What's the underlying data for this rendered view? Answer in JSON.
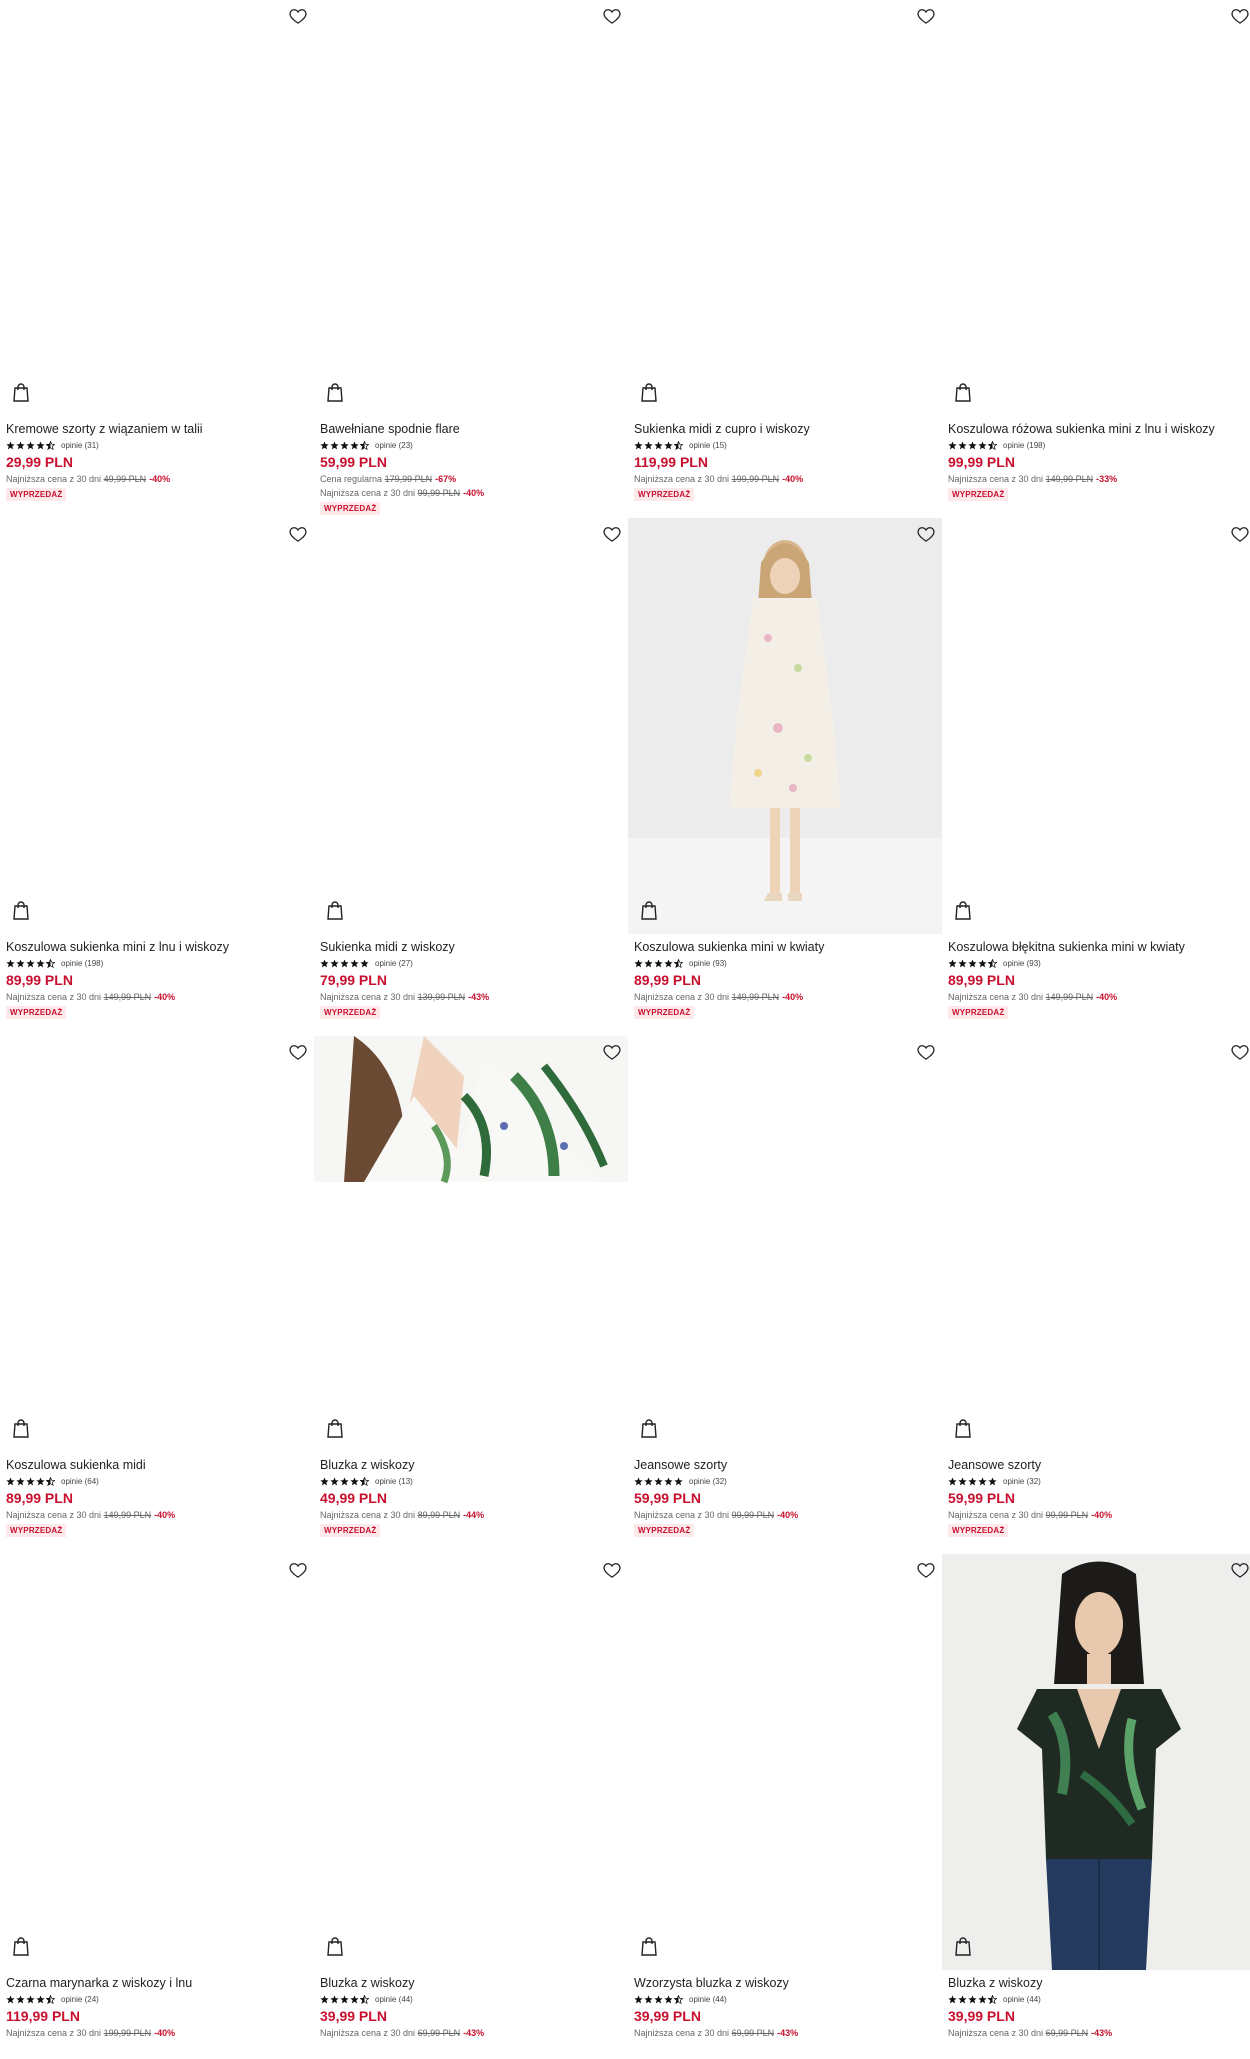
{
  "products": [
    {
      "name": "Kremowe szorty z wiązaniem w talii",
      "reviews": "opinie (31)",
      "price": "29,99 PLN",
      "regular_label": "",
      "regular_old": "",
      "regular_disc": "",
      "lowest_label": "Najniższa cena z 30 dni",
      "lowest_old": "49,99 PLN",
      "lowest_disc": "-40%",
      "badge": "WYPRZEDAŻ",
      "rating": 4.5,
      "image": "blank"
    },
    {
      "name": "Bawełniane spodnie flare",
      "reviews": "opinie (23)",
      "price": "59,99 PLN",
      "regular_label": "Cena regularna",
      "regular_old": "179,99 PLN",
      "regular_disc": "-67%",
      "lowest_label": "Najniższa cena z 30 dni",
      "lowest_old": "99,99 PLN",
      "lowest_disc": "-40%",
      "badge": "WYPRZEDAŻ",
      "rating": 4.5,
      "image": "blank"
    },
    {
      "name": "Sukienka midi z cupro i wiskozy",
      "reviews": "opinie (15)",
      "price": "119,99 PLN",
      "regular_label": "",
      "regular_old": "",
      "regular_disc": "",
      "lowest_label": "Najniższa cena z 30 dni",
      "lowest_old": "199,99 PLN",
      "lowest_disc": "-40%",
      "badge": "WYPRZEDAŻ",
      "rating": 4.5,
      "image": "blank"
    },
    {
      "name": "Koszulowa różowa sukienka mini z lnu i wiskozy",
      "reviews": "opinie (198)",
      "price": "99,99 PLN",
      "regular_label": "",
      "regular_old": "",
      "regular_disc": "",
      "lowest_label": "Najniższa cena z 30 dni",
      "lowest_old": "149,99 PLN",
      "lowest_disc": "-33%",
      "badge": "WYPRZEDAŻ",
      "rating": 4.5,
      "image": "blank"
    },
    {
      "name": "Koszulowa sukienka mini z lnu i wiskozy",
      "reviews": "opinie (198)",
      "price": "89,99 PLN",
      "regular_label": "",
      "regular_old": "",
      "regular_disc": "",
      "lowest_label": "Najniższa cena z 30 dni",
      "lowest_old": "149,99 PLN",
      "lowest_disc": "-40%",
      "badge": "WYPRZEDAŻ",
      "rating": 4.5,
      "image": "blank"
    },
    {
      "name": "Sukienka midi z wiskozy",
      "reviews": "opinie (27)",
      "price": "79,99 PLN",
      "regular_label": "",
      "regular_old": "",
      "regular_disc": "",
      "lowest_label": "Najniższa cena z 30 dni",
      "lowest_old": "139,99 PLN",
      "lowest_disc": "-43%",
      "badge": "WYPRZEDAŻ",
      "rating": 5,
      "image": "blank"
    },
    {
      "name": "Koszulowa sukienka mini w kwiaty",
      "reviews": "opinie (93)",
      "price": "89,99 PLN",
      "regular_label": "",
      "regular_old": "",
      "regular_disc": "",
      "lowest_label": "Najniższa cena z 30 dni",
      "lowest_old": "149,99 PLN",
      "lowest_disc": "-40%",
      "badge": "WYPRZEDAŻ",
      "rating": 4.5,
      "image": "dress"
    },
    {
      "name": "Koszulowa błękitna sukienka mini w kwiaty",
      "reviews": "opinie (93)",
      "price": "89,99 PLN",
      "regular_label": "",
      "regular_old": "",
      "regular_disc": "",
      "lowest_label": "Najniższa cena z 30 dni",
      "lowest_old": "149,99 PLN",
      "lowest_disc": "-40%",
      "badge": "WYPRZEDAŻ",
      "rating": 4.5,
      "image": "blank"
    },
    {
      "name": "Koszulowa sukienka midi",
      "reviews": "opinie (64)",
      "price": "89,99 PLN",
      "regular_label": "",
      "regular_old": "",
      "regular_disc": "",
      "lowest_label": "Najniższa cena z 30 dni",
      "lowest_old": "149,99 PLN",
      "lowest_disc": "-40%",
      "badge": "WYPRZEDAŻ",
      "rating": 4.5,
      "image": "blank"
    },
    {
      "name": "Bluzka z wiskozy",
      "reviews": "opinie (13)",
      "price": "49,99 PLN",
      "regular_label": "",
      "regular_old": "",
      "regular_disc": "",
      "lowest_label": "Najniższa cena z 30 dni",
      "lowest_old": "89,99 PLN",
      "lowest_disc": "-44%",
      "badge": "WYPRZEDAŻ",
      "rating": 4.5,
      "image": "leaves-partial"
    },
    {
      "name": "Jeansowe szorty",
      "reviews": "opinie (32)",
      "price": "59,99 PLN",
      "regular_label": "",
      "regular_old": "",
      "regular_disc": "",
      "lowest_label": "Najniższa cena z 30 dni",
      "lowest_old": "99,99 PLN",
      "lowest_disc": "-40%",
      "badge": "WYPRZEDAŻ",
      "rating": 5,
      "image": "blank"
    },
    {
      "name": "Jeansowe szorty",
      "reviews": "opinie (32)",
      "price": "59,99 PLN",
      "regular_label": "",
      "regular_old": "",
      "regular_disc": "",
      "lowest_label": "Najniższa cena z 30 dni",
      "lowest_old": "99,99 PLN",
      "lowest_disc": "-40%",
      "badge": "WYPRZEDAŻ",
      "rating": 5,
      "image": "blank"
    },
    {
      "name": "Czarna marynarka z wiskozy i lnu",
      "reviews": "opinie (24)",
      "price": "119,99 PLN",
      "regular_label": "",
      "regular_old": "",
      "regular_disc": "",
      "lowest_label": "Najniższa cena z 30 dni",
      "lowest_old": "199,99 PLN",
      "lowest_disc": "-40%",
      "badge": "",
      "rating": 4.5,
      "image": "blank"
    },
    {
      "name": "Bluzka z wiskozy",
      "reviews": "opinie (44)",
      "price": "39,99 PLN",
      "regular_label": "",
      "regular_old": "",
      "regular_disc": "",
      "lowest_label": "Najniższa cena z 30 dni",
      "lowest_old": "69,99 PLN",
      "lowest_disc": "-43%",
      "badge": "",
      "rating": 4.5,
      "image": "blank"
    },
    {
      "name": "Wzorzysta bluzka z wiskozy",
      "reviews": "opinie (44)",
      "price": "39,99 PLN",
      "regular_label": "",
      "regular_old": "",
      "regular_disc": "",
      "lowest_label": "Najniższa cena z 30 dni",
      "lowest_old": "69,99 PLN",
      "lowest_disc": "-43%",
      "badge": "",
      "rating": 4.5,
      "image": "blank"
    },
    {
      "name": "Bluzka z wiskozy",
      "reviews": "opinie (44)",
      "price": "39,99 PLN",
      "regular_label": "",
      "regular_old": "",
      "regular_disc": "",
      "lowest_label": "Najniższa cena z 30 dni",
      "lowest_old": "69,99 PLN",
      "lowest_disc": "-43%",
      "badge": "",
      "rating": 4.5,
      "image": "blouse"
    }
  ],
  "colors": {
    "price": "#c8102e",
    "badge_bg": "#fde8ea",
    "text": "#222222",
    "star": "#111111"
  },
  "icons": {
    "favorite": "heart-outline-icon",
    "cart": "shopping-bag-icon",
    "rating": "star-icon"
  }
}
